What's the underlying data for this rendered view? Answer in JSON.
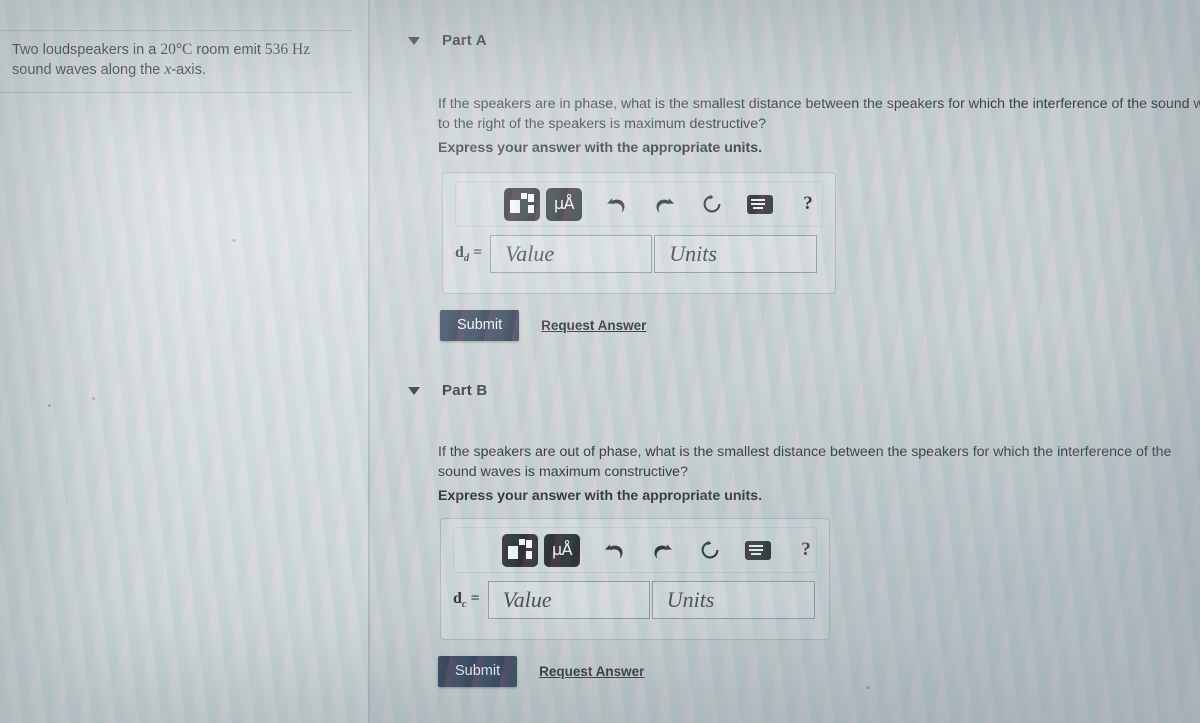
{
  "problem": {
    "statement_pre": "Two loudspeakers in a ",
    "temperature": "20°C",
    "statement_mid": " room emit ",
    "frequency": "536 Hz",
    "statement_post": " sound waves along the ",
    "axis_var": "x",
    "statement_end": "-axis."
  },
  "parts": [
    {
      "id": "part-a",
      "caret_icon": "caret-down-icon",
      "title": "Part A",
      "question": "If the speakers are in phase, what is the smallest distance between the speakers for which the interference of the sound waves to the right of the speakers is maximum destructive?",
      "express": "Express your answer with the appropriate units.",
      "answer": {
        "variable": "d",
        "subscript": "d",
        "equals": "=",
        "value_placeholder": "Value",
        "units_placeholder": "Units",
        "value_text": "",
        "units_text": ""
      },
      "toolbar": {
        "template_icon": "math-template-icon",
        "units_icon": "micro-angstrom-units-icon",
        "units_label": "μÅ",
        "undo_icon": "undo-arrow-icon",
        "redo_icon": "redo-arrow-icon",
        "reset_icon": "reset-circular-arrow-icon",
        "keyboard_icon": "keyboard-icon",
        "help_icon": "help-question-mark-icon",
        "help_label": "?"
      },
      "submit_label": "Submit",
      "request_label": "Request Answer"
    },
    {
      "id": "part-b",
      "caret_icon": "caret-down-icon",
      "title": "Part B",
      "question": "If the speakers are out of phase, what is the smallest distance between the speakers for which the interference of the sound waves is maximum constructive?",
      "express": "Express your answer with the appropriate units.",
      "answer": {
        "variable": "d",
        "subscript": "c",
        "equals": "=",
        "value_placeholder": "Value",
        "units_placeholder": "Units",
        "value_text": "",
        "units_text": ""
      },
      "toolbar": {
        "template_icon": "math-template-icon",
        "units_icon": "micro-angstrom-units-icon",
        "units_label": "μÅ",
        "undo_icon": "undo-arrow-icon",
        "redo_icon": "redo-arrow-icon",
        "reset_icon": "reset-circular-arrow-icon",
        "keyboard_icon": "keyboard-icon",
        "help_icon": "help-question-mark-icon",
        "help_label": "?"
      },
      "submit_label": "Submit",
      "request_label": "Request Answer"
    }
  ],
  "colors": {
    "submit_button": "#1b2a44",
    "toolbar_button": "#14181c",
    "page_background": "#c3cbcd",
    "text": "#15191d"
  }
}
